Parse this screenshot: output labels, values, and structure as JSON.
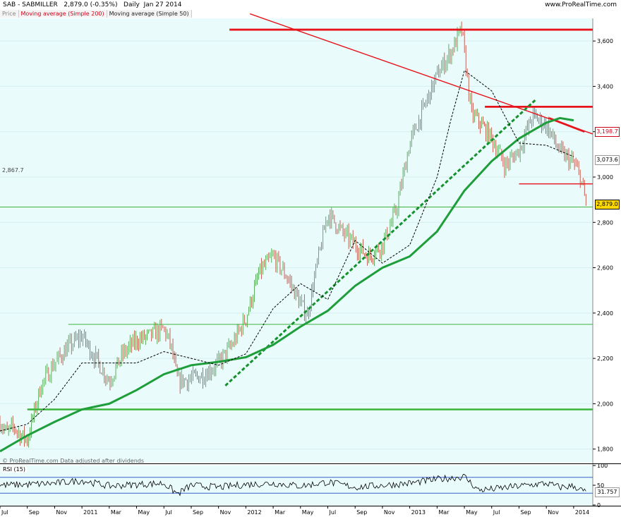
{
  "header": {
    "symbol": "SAB - SABMILLER",
    "last": "2,879.0 (-0.35%)",
    "period": "Daily",
    "date": "Jan 27 2014",
    "website": "www.ProRealTime.com"
  },
  "tabs": {
    "price": "Price",
    "ma200": "Moving average (Simple 200)",
    "ma50": "Moving average (Simple 50)"
  },
  "copyright": "© ProRealTime.com Data adjusted after dividends",
  "rsi_label": "RSI (15)",
  "colors": {
    "up": "#3a9b3a",
    "down": "#c0392b",
    "ma200": "#1e9e3a",
    "ma50": "#000000",
    "trend_red": "#e8141c",
    "support_green": "#3cb43c",
    "chart_bg": "#e9fbfb"
  },
  "chart_data": [
    {
      "type": "line",
      "title": "SAB - SABMILLER",
      "ylim": [
        1740,
        3700
      ],
      "yticks": [
        "3,600",
        "3,400",
        "3,200",
        "3,000",
        "2,800",
        "2,600",
        "2,400",
        "2,200",
        "2,000",
        "1,800"
      ],
      "ytick_values": [
        3600,
        3400,
        3200,
        3000,
        2800,
        2600,
        2400,
        2200,
        2000,
        1800
      ],
      "xticks": [
        "Jul",
        "Sep",
        "Nov",
        "2011",
        "Mar",
        "May",
        "Jul",
        "Sep",
        "Nov",
        "2012",
        "Mar",
        "May",
        "Jul",
        "Sep",
        "Nov",
        "2013",
        "Mar",
        "May",
        "Jul",
        "Sep",
        "Nov",
        "2014"
      ],
      "xtick_months": [
        0,
        2,
        4,
        6,
        8,
        10,
        12,
        14,
        16,
        18,
        20,
        22,
        24,
        26,
        28,
        30,
        32,
        34,
        36,
        38,
        40,
        42
      ],
      "xlim": [
        0,
        43.4
      ],
      "price_months": [
        0,
        0.5,
        1,
        1.5,
        2,
        3,
        4,
        5,
        6,
        7,
        8,
        9,
        10,
        11,
        12,
        12.5,
        13,
        14,
        15,
        16,
        17,
        18,
        19,
        20,
        21,
        22,
        22.5,
        23,
        24,
        25,
        26,
        27,
        28,
        29,
        30,
        31,
        32,
        33,
        33.8,
        34.5,
        35,
        36,
        37,
        38,
        39,
        40,
        41,
        42,
        42.5,
        42.9
      ],
      "price_values": [
        1920,
        1870,
        1900,
        1860,
        1840,
        2080,
        2180,
        2250,
        2300,
        2200,
        2100,
        2220,
        2280,
        2300,
        2330,
        2260,
        2100,
        2110,
        2130,
        2180,
        2260,
        2380,
        2580,
        2650,
        2560,
        2440,
        2390,
        2550,
        2840,
        2760,
        2700,
        2650,
        2700,
        2850,
        3150,
        3300,
        3450,
        3550,
        3650,
        3280,
        3250,
        3170,
        3050,
        3120,
        3270,
        3230,
        3110,
        3060,
        3000,
        2879
      ],
      "series": [
        {
          "name": "Moving average (Simple 200)",
          "x": [
            0,
            2,
            4,
            6,
            8,
            10,
            12,
            14,
            16,
            18,
            20,
            22,
            24,
            26,
            28,
            30,
            32,
            34,
            36,
            38,
            40,
            41,
            42
          ],
          "values": [
            1790,
            1860,
            1920,
            1975,
            2000,
            2060,
            2130,
            2170,
            2185,
            2205,
            2260,
            2340,
            2410,
            2520,
            2600,
            2650,
            2760,
            2940,
            3070,
            3170,
            3240,
            3260,
            3250
          ]
        },
        {
          "name": "Moving average (Simple 50)",
          "x": [
            0,
            2,
            4,
            6,
            8,
            10,
            12,
            14,
            16,
            18,
            20,
            22,
            24,
            26,
            28,
            30,
            32,
            33,
            34,
            36,
            38,
            40,
            42
          ],
          "values": [
            1880,
            1910,
            2020,
            2180,
            2180,
            2180,
            2230,
            2200,
            2170,
            2220,
            2420,
            2530,
            2460,
            2720,
            2620,
            2700,
            3000,
            3250,
            3470,
            3380,
            3150,
            3140,
            3090
          ]
        }
      ],
      "annotations": [
        {
          "kind": "level",
          "value": 2867.7,
          "label": "2,867.7",
          "style": "green-thin"
        },
        {
          "kind": "level",
          "value": 3650,
          "from": 16.8,
          "to": 43.4,
          "style": "red-thick"
        },
        {
          "kind": "level",
          "value": 3310,
          "from": 35.5,
          "to": 43.4,
          "style": "red-thick"
        },
        {
          "kind": "level",
          "value": 2970,
          "from": 38.0,
          "to": 43.4,
          "style": "red-thin"
        },
        {
          "kind": "level",
          "value": 1975,
          "from": 2.0,
          "to": 43.4,
          "style": "green-thick"
        },
        {
          "kind": "level",
          "value": 2350,
          "from": 5.0,
          "to": 43.4,
          "style": "green-thin"
        },
        {
          "kind": "trend",
          "x": [
            18.3,
            43.4
          ],
          "y": [
            3720,
            3190
          ],
          "style": "red-thin"
        },
        {
          "kind": "trend",
          "x": [
            40.2,
            42.8
          ],
          "y": [
            3260,
            3200
          ],
          "style": "red-thick"
        },
        {
          "kind": "trend",
          "x": [
            16.5,
            39.2
          ],
          "y": [
            2080,
            3340
          ],
          "style": "green-dashed"
        }
      ],
      "price_tags": [
        {
          "label": "3,198.7",
          "value": 3198.7,
          "style": "red"
        },
        {
          "label": "3,073.6",
          "value": 3073.6,
          "style": "gray"
        },
        {
          "label": "2,879.0",
          "value": 2879.0,
          "style": "yellow"
        }
      ]
    },
    {
      "type": "line",
      "title": "RSI (15)",
      "ylim": [
        0,
        100
      ],
      "yticks": [
        "100",
        "50",
        "0"
      ],
      "ytick_values": [
        100,
        50,
        0
      ],
      "levels": [
        70,
        30
      ],
      "last_value": "31.757",
      "x": [
        0,
        2,
        4,
        6,
        8,
        10,
        12,
        13,
        14,
        16,
        18,
        20,
        22,
        24,
        26,
        28,
        30,
        32,
        34,
        35,
        36,
        38,
        40,
        41,
        42,
        42.9
      ],
      "values": [
        50,
        52,
        55,
        62,
        48,
        52,
        55,
        28,
        50,
        45,
        52,
        55,
        48,
        58,
        45,
        50,
        55,
        65,
        72,
        38,
        40,
        48,
        55,
        45,
        48,
        31.757
      ]
    }
  ]
}
